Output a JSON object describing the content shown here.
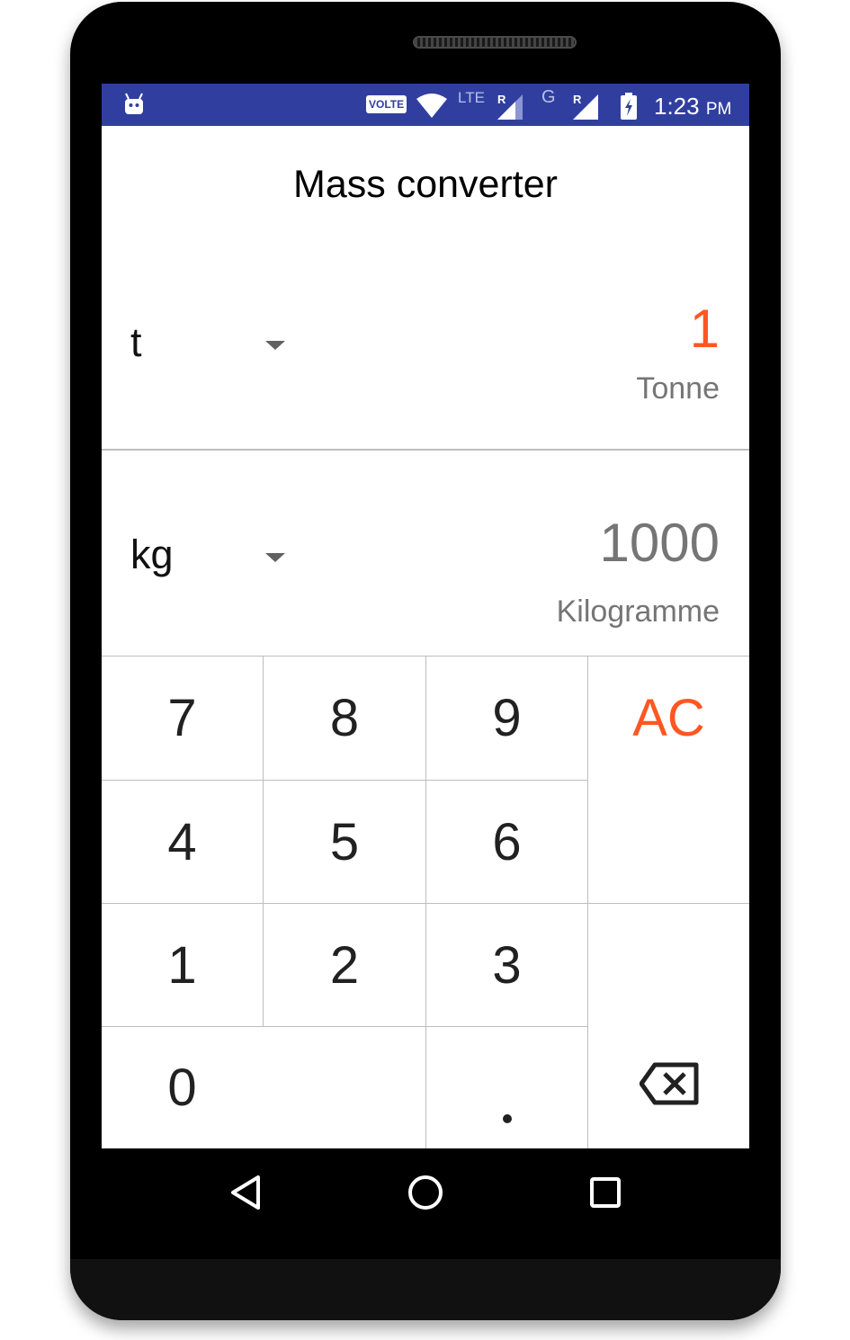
{
  "status_bar": {
    "volte": "VOLTE",
    "lte": "LTE",
    "roaming_1": "R",
    "network_g": "G",
    "roaming_2": "R",
    "time": "1:23",
    "ampm": "PM",
    "color": "#303f9f"
  },
  "app": {
    "title": "Mass converter"
  },
  "from_unit": {
    "symbol": "t",
    "value": "1",
    "name": "Tonne",
    "value_color": "#ff5722"
  },
  "to_unit": {
    "symbol": "kg",
    "value": "1000",
    "name": "Kilogramme",
    "value_color": "#757575"
  },
  "keypad": {
    "k7": "7",
    "k8": "8",
    "k9": "9",
    "ac": "AC",
    "k4": "4",
    "k5": "5",
    "k6": "6",
    "k1": "1",
    "k2": "2",
    "k3": "3",
    "k0": "0",
    "dot": ".",
    "backspace_icon": "backspace-icon",
    "accent": "#ff5722"
  },
  "nav_bar": {
    "back_icon": "back-triangle-icon",
    "home_icon": "home-circle-icon",
    "recents_icon": "recents-square-icon"
  }
}
